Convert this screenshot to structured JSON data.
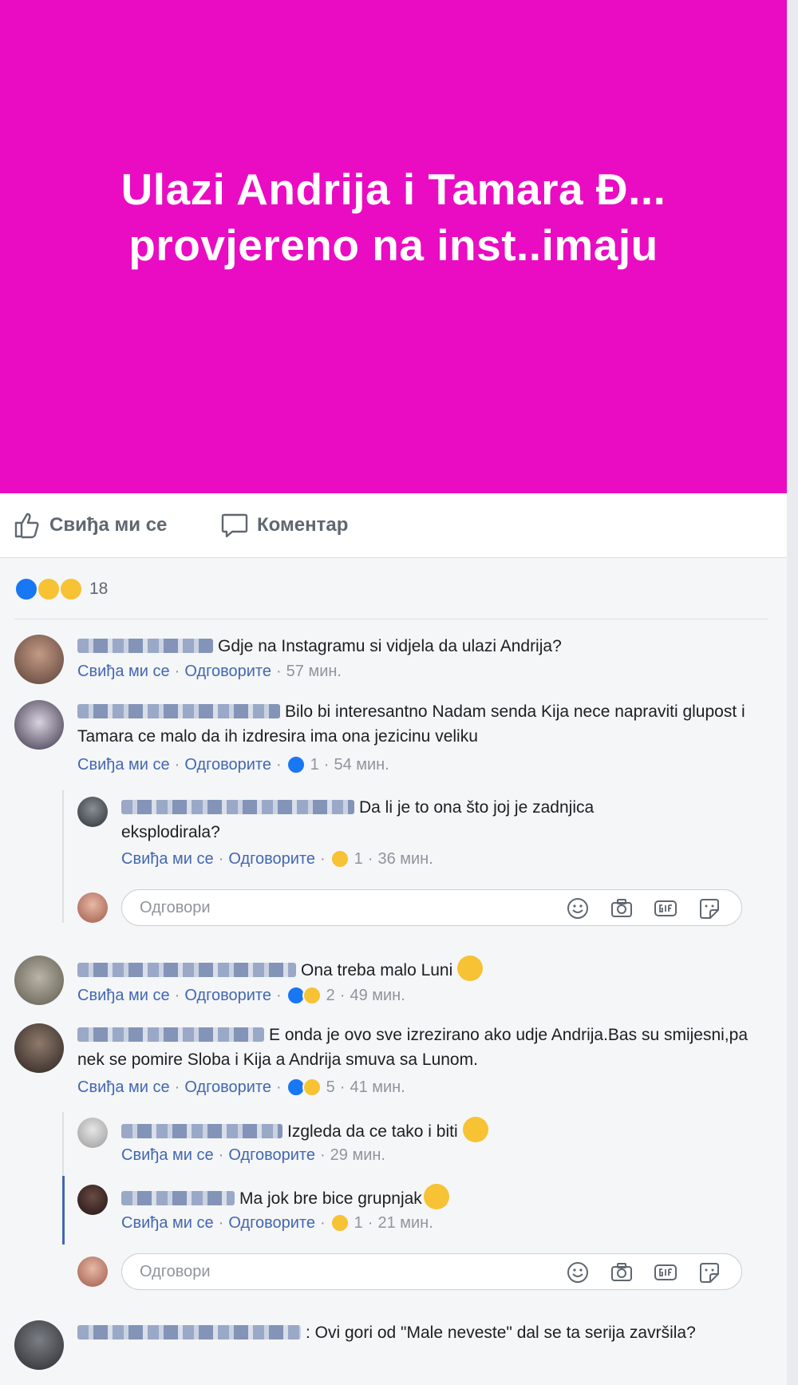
{
  "post": {
    "banner_text": "Ulazi Andrija i Tamara Đ... provjereno na inst..imaju",
    "banner_color": "#e90cc2"
  },
  "actions": {
    "like_label": "Свиђа ми се",
    "comment_label": "Коментар"
  },
  "reactions": {
    "types": [
      "like-icon",
      "haha-icon",
      "wow-icon"
    ],
    "count": "18"
  },
  "labels": {
    "like": "Свиђа ми се",
    "reply": "Одговорите",
    "reply_placeholder": "Одговори",
    "sep": "·"
  },
  "comments": [
    {
      "text": "Gdje na Instagramu si vidjela da ulazi Andrija?",
      "time": "57 мин."
    },
    {
      "text": "Bilo bi interesantno Nadam senda Kija nece napraviti glupost i Tamara ce malo da ih izdresira ima ona jezicinu veliku",
      "reaction_count": "1",
      "time": "54 мин."
    },
    {
      "text": "Da li je to ona što joj je zadnjica eksplodirala?",
      "reaction_count": "1",
      "time": "36 мин."
    },
    {
      "text": "Ona treba malo Luni",
      "reaction_count": "2",
      "time": "49 мин."
    },
    {
      "text": "E onda je ovo sve izrezirano ako udje Andrija.Bas su smijesni,pa nek se pomire Sloba i Kija a Andrija smuva sa Lunom.",
      "reaction_count": "5",
      "time": "41 мин."
    },
    {
      "text": "Izgleda da ce tako i biti",
      "time": "29 мин."
    },
    {
      "text": "Ma jok bre bice grupnjak",
      "reaction_count": "1",
      "time": "21 мин."
    },
    {
      "text": ": Ovi gori od \"Male neveste\" dal se ta serija završila?"
    }
  ],
  "colors": {
    "link": "#4267b2",
    "like_blue": "#1877f2",
    "emoji_yellow": "#f7c233",
    "meta_gray": "#90949c"
  }
}
